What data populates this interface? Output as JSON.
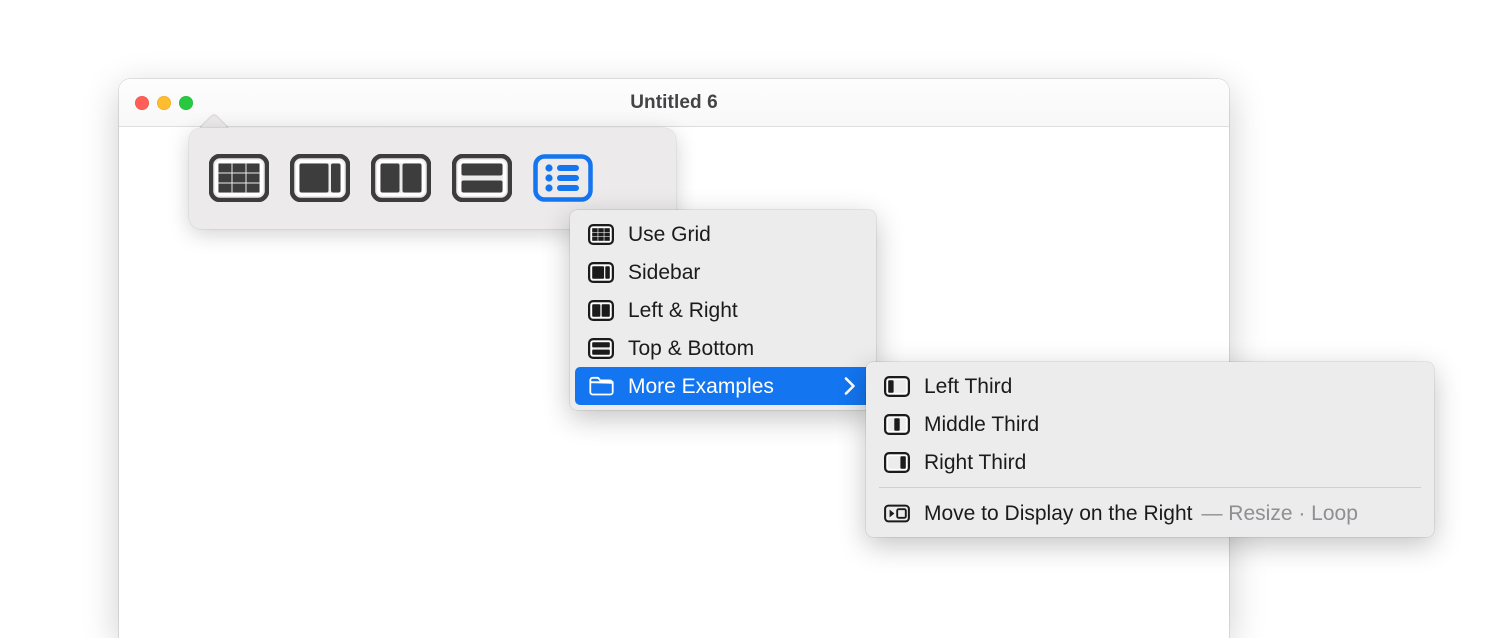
{
  "window": {
    "title": "Untitled 6",
    "traffic_lights": [
      {
        "name": "close",
        "color": "#ff5f57"
      },
      {
        "name": "minimize",
        "color": "#febc2e"
      },
      {
        "name": "zoom",
        "color": "#28c840"
      }
    ]
  },
  "popover": {
    "segments": [
      {
        "id": "use-grid",
        "icon": "grid-layout-icon",
        "selected": false
      },
      {
        "id": "sidebar",
        "icon": "sidebar-layout-icon",
        "selected": false
      },
      {
        "id": "left-right",
        "icon": "left-right-layout-icon",
        "selected": false
      },
      {
        "id": "top-bottom",
        "icon": "top-bottom-layout-icon",
        "selected": false
      },
      {
        "id": "list",
        "icon": "list-view-icon",
        "selected": true
      }
    ]
  },
  "menu_main": {
    "items": [
      {
        "label": "Use Grid",
        "icon": "grid-layout-icon",
        "selected": false,
        "submenu": false
      },
      {
        "label": "Sidebar",
        "icon": "sidebar-layout-icon",
        "selected": false,
        "submenu": false
      },
      {
        "label": "Left & Right",
        "icon": "left-right-layout-icon",
        "selected": false,
        "submenu": false
      },
      {
        "label": "Top & Bottom",
        "icon": "top-bottom-layout-icon",
        "selected": false,
        "submenu": false
      },
      {
        "label": "More Examples",
        "icon": "folder-icon",
        "selected": true,
        "submenu": true
      }
    ]
  },
  "menu_sub": {
    "items": [
      {
        "label": "Left Third",
        "icon": "left-third-icon",
        "suffix": ""
      },
      {
        "label": "Middle Third",
        "icon": "middle-third-icon",
        "suffix": ""
      },
      {
        "label": "Right Third",
        "icon": "right-third-icon",
        "suffix": ""
      }
    ],
    "footer": {
      "label": "Move to Display on the Right",
      "icon": "move-to-display-right-icon",
      "suffix": "— Resize · Loop"
    }
  },
  "colors": {
    "accent": "#1375f0",
    "menu_bg": "#ececec",
    "popover_bg": "#eceaea",
    "glyph_dark": "#3d3d3d",
    "glyph_black": "#1b1b1c",
    "muted_text": "#8e8e93"
  }
}
